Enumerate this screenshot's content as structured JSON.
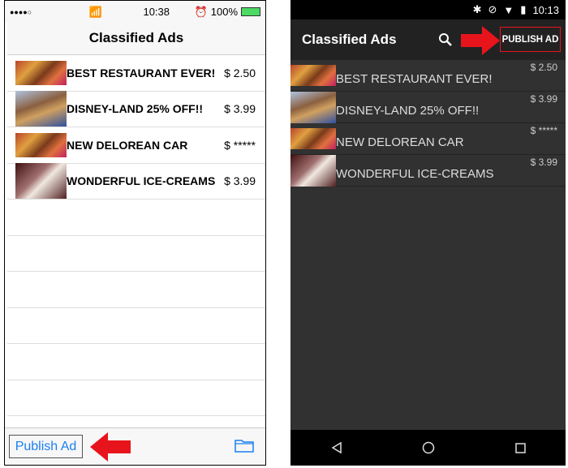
{
  "ios": {
    "status": {
      "signal": "●●●●○",
      "time": "10:38",
      "battery": "100%"
    },
    "title": "Classified Ads",
    "publish_label": "Publish Ad",
    "folder_icon": "folder-icon"
  },
  "android": {
    "status": {
      "time": "10:13"
    },
    "title": "Classified Ads",
    "publish_label": "PUBLISH AD",
    "search_icon": "search-icon"
  },
  "ads": [
    {
      "title": "BEST RESTAURANT EVER!",
      "price": "$ 2.50",
      "image": "food"
    },
    {
      "title": "DISNEY-LAND 25% OFF!!",
      "price": "$ 3.99",
      "image": "disney"
    },
    {
      "title": "NEW DELOREAN CAR",
      "price": "$ *****",
      "image": "food"
    },
    {
      "title": "WONDERFUL ICE-CREAMS",
      "price": "$ 3.99",
      "image": "ice"
    }
  ],
  "colors": {
    "ios_accent": "#1a7ff0",
    "arrow": "#e8141c"
  }
}
